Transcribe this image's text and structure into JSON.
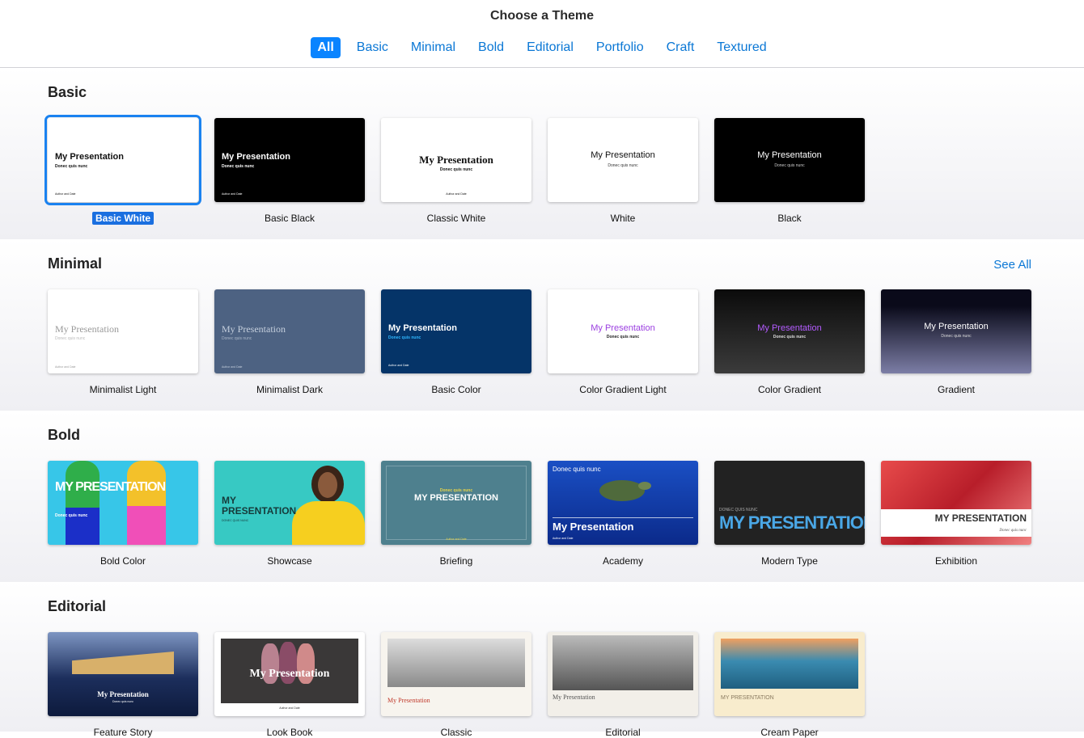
{
  "header": {
    "title": "Choose a Theme",
    "tabs": [
      {
        "label": "All",
        "active": true
      },
      {
        "label": "Basic"
      },
      {
        "label": "Minimal"
      },
      {
        "label": "Bold"
      },
      {
        "label": "Editorial"
      },
      {
        "label": "Portfolio"
      },
      {
        "label": "Craft"
      },
      {
        "label": "Textured"
      }
    ]
  },
  "thumb_text": {
    "title": "My Presentation",
    "title_caps": "MY PRESENTATION",
    "subtitle": "Donec quis nunc",
    "subtitle_caps": "DONEC QUIS NUNC",
    "footer": "Author and Date"
  },
  "sections": [
    {
      "title": "Basic",
      "themes": [
        "Basic White",
        "Basic Black",
        "Classic White",
        "White",
        "Black"
      ]
    },
    {
      "title": "Minimal",
      "see_all": "See All",
      "themes": [
        "Minimalist Light",
        "Minimalist Dark",
        "Basic Color",
        "Color Gradient Light",
        "Color Gradient",
        "Gradient"
      ]
    },
    {
      "title": "Bold",
      "themes": [
        "Bold Color",
        "Showcase",
        "Briefing",
        "Academy",
        "Modern Type",
        "Exhibition"
      ]
    },
    {
      "title": "Editorial",
      "themes": [
        "Feature Story",
        "Look Book",
        "Classic",
        "Editorial",
        "Cream Paper"
      ]
    }
  ],
  "colors": {
    "accent": "#0a84ff",
    "link": "#0a77d5",
    "selection": "#1a6fe0"
  }
}
